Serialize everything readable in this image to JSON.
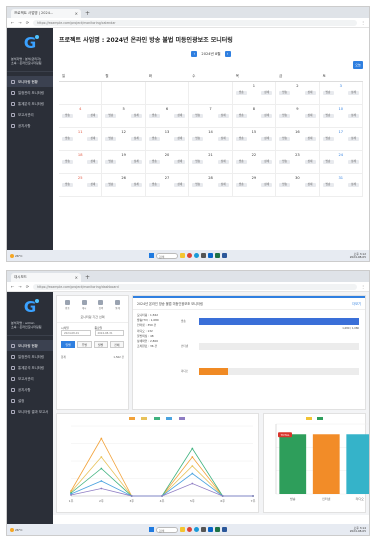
{
  "screen1": {
    "tab_title": "프로젝트 사업명 | 2024...",
    "url": "https://example.com/project/monitoring/calendar",
    "page_title": "프로젝트 사업명 : 2024년 온라인 방송 불법 미등인광보조 모니터링",
    "month_label": "2024년 8월",
    "today_label": "오늘",
    "user_line1": "분석자명 : 분석(관리자)",
    "user_line2": "소속 : 온라인모니터링팀",
    "menu": [
      "모니터링 현황",
      "일정관리 모니터링",
      "통계분석 모니터링",
      "보고서관리",
      "공지사항"
    ],
    "weekdays": [
      "일",
      "월",
      "화",
      "수",
      "목",
      "금",
      "토"
    ],
    "days": [
      "",
      "",
      "",
      "",
      "1",
      "2",
      "3",
      "4",
      "5",
      "6",
      "7",
      "8",
      "9",
      "10",
      "11",
      "12",
      "13",
      "14",
      "15",
      "16",
      "17",
      "18",
      "19",
      "20",
      "21",
      "22",
      "23",
      "24",
      "25",
      "26",
      "27",
      "28",
      "29",
      "30",
      "31"
    ],
    "chip_labels": [
      "방송",
      "상세"
    ],
    "taskbar_weather": "26°C",
    "taskbar_search": "검색",
    "clock_time": "오후 3:12",
    "clock_date": "2024-08-05"
  },
  "screen2": {
    "tab_title": "대시보드",
    "url": "https://example.com/project/monitoring/dashboard",
    "user_line1": "분석자명 : admin",
    "user_line2": "소속 : 온라인모니터링팀",
    "menu": [
      "모니터링 현황",
      "일정관리 모니터링",
      "통계분석 모니터링",
      "보고서관리",
      "공지사항",
      "설정",
      "모니터링 결과 보고서"
    ],
    "ctrl_icons": [
      "방송",
      "게시",
      "검색",
      "통계"
    ],
    "ctrl_title": "모니터링 기간 선택",
    "start_label": "시작일",
    "end_label": "종료일",
    "start_value": "2024-08-01",
    "end_value": "2024-08-31",
    "period_buttons": [
      "일별",
      "주별",
      "월별",
      "전체"
    ],
    "note_left": "합계",
    "note_right": "1,562 건",
    "stats_title": "2024년 온라인 방송 불법 미등인광보조 모니터링",
    "stats_more": "더보기",
    "stat_lines": [
      "모니터링 : 1,562",
      "방송(TV) : 1,080",
      "인터넷 : 350 건",
      "라디오 : 132",
      "불법의심 : 48",
      "상세확인 : 2,800",
      "조치완료 : 36 건"
    ],
    "hbars": [
      {
        "label": "방송",
        "fraction": 1.0,
        "color": "#3a6fd8",
        "value": "1,080 / 1,080"
      },
      {
        "label": "인터넷",
        "fraction": 0.0,
        "color": "#3a6fd8",
        "value": ""
      },
      {
        "label": "라디오",
        "fraction": 0.18,
        "color": "#f08a24",
        "value": ""
      }
    ],
    "clock_time": "오후 3:14",
    "clock_date": "2024-08-05"
  },
  "line_chart": {
    "type": "line",
    "categories": [
      "1주",
      "2주",
      "3주",
      "4주",
      "5주",
      "6주",
      "7주"
    ],
    "series": [
      {
        "name": "",
        "color": "#f2a23a",
        "values": [
          10,
          115,
          0,
          0,
          78,
          0,
          0
        ]
      },
      {
        "name": "",
        "color": "#e8c25a",
        "values": [
          8,
          78,
          0,
          0,
          60,
          0,
          0
        ]
      },
      {
        "name": "",
        "color": "#3fb27f",
        "values": [
          6,
          55,
          0,
          0,
          95,
          0,
          0
        ]
      },
      {
        "name": "",
        "color": "#4aa3df",
        "values": [
          4,
          30,
          0,
          0,
          45,
          0,
          0
        ]
      },
      {
        "name": "",
        "color": "#8e7cc3",
        "values": [
          2,
          15,
          0,
          0,
          25,
          0,
          0
        ]
      }
    ],
    "ylim": [
      0,
      140
    ]
  },
  "bar_chart": {
    "type": "bar",
    "categories": [
      "방송",
      "인터넷",
      "라디오",
      "기타"
    ],
    "series": [
      {
        "name": "",
        "values": [
          128,
          128,
          128,
          128
        ]
      }
    ],
    "colors": [
      "#2e9e5b",
      "#f28c28",
      "#35b3c9",
      "#f2c335"
    ],
    "ylim": [
      0,
      150
    ],
    "badge": "TOTAL"
  },
  "icons": {
    "logo": "g-logo-icon",
    "search": "search-icon",
    "prev": "chevron-left-icon",
    "next": "chevron-right-icon"
  }
}
